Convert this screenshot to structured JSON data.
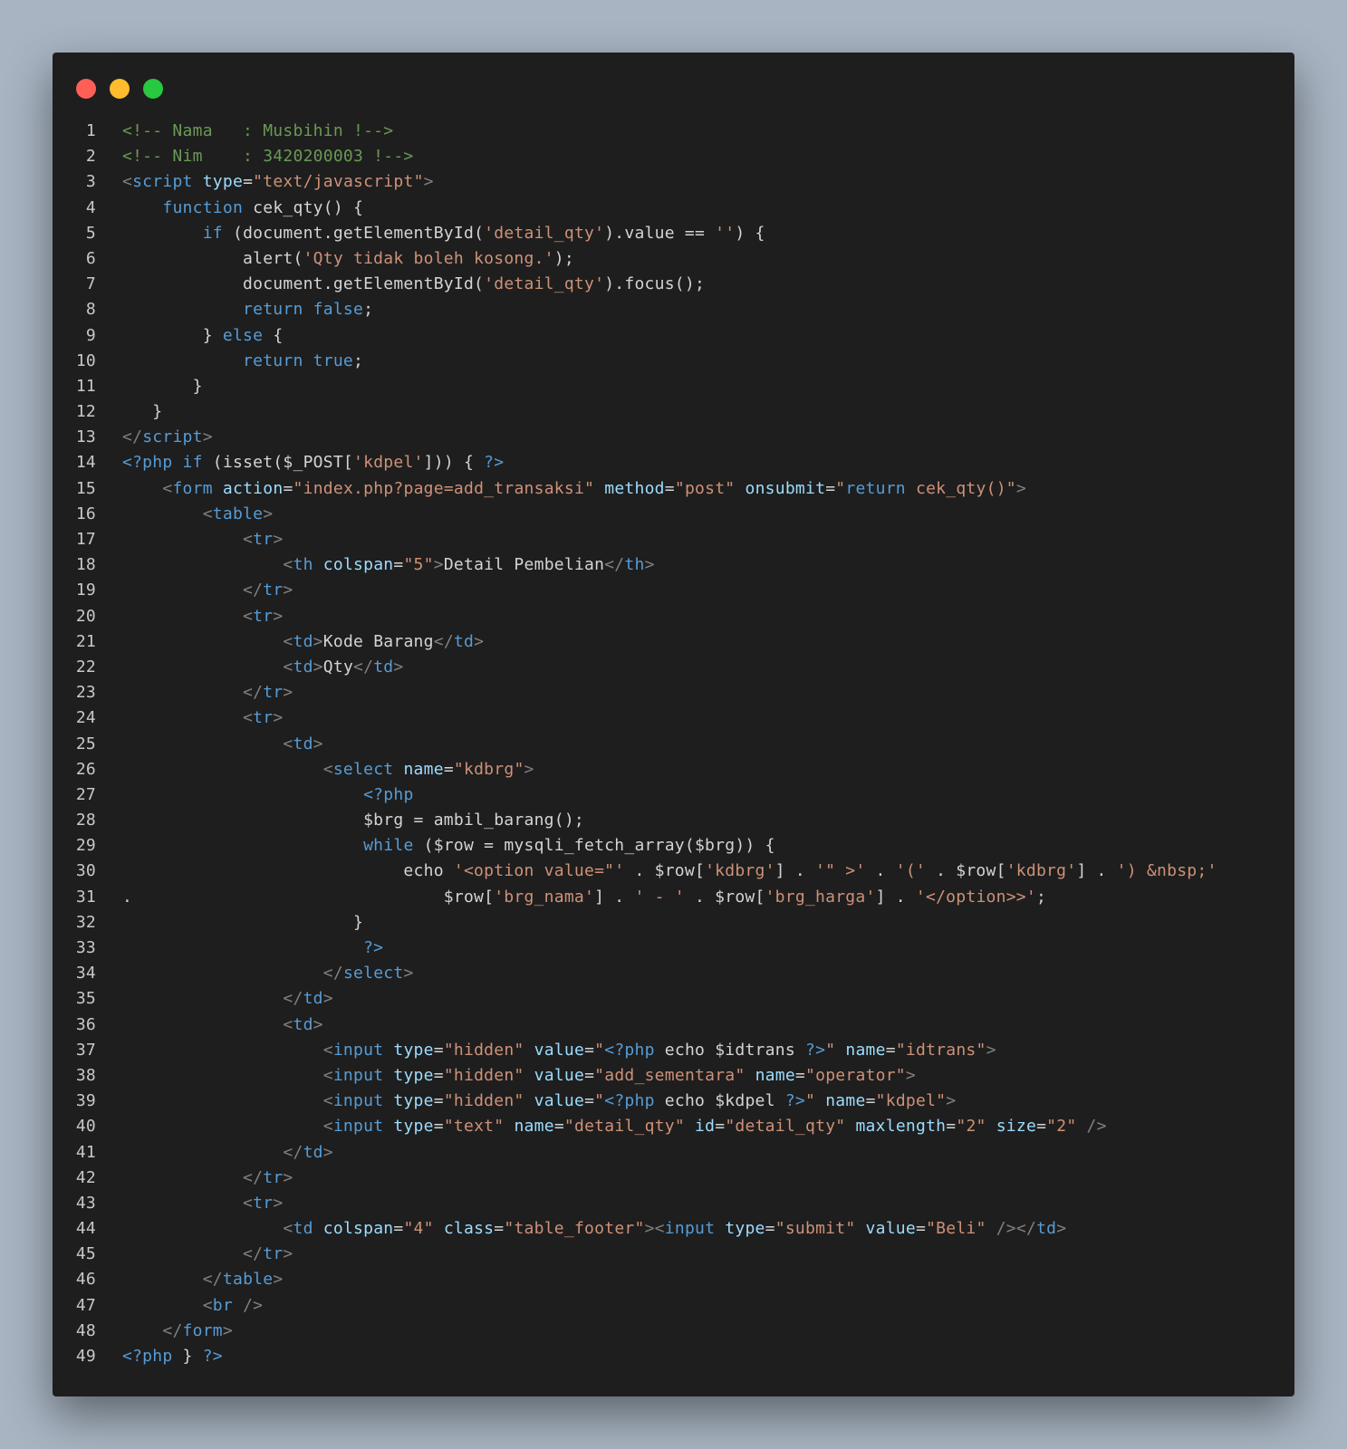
{
  "window": {
    "colors": {
      "background": "#1e1e1e",
      "close": "#ff5f57",
      "minimize": "#febc2e",
      "maximize": "#28c840"
    }
  },
  "syntax_colors": {
    "text": "#d4d4d4",
    "comment": "#6a9955",
    "tag": "#569cd6",
    "bracket": "#808080",
    "attr": "#9cdcfe",
    "string": "#ce9178",
    "keyword": "#569cd6"
  },
  "code_lines": [
    [
      [
        "comment",
        "<!-- Nama   : Musbihin !-->"
      ]
    ],
    [
      [
        "comment",
        "<!-- Nim    : 3420200003 !-->"
      ]
    ],
    [
      [
        "bracket",
        "<"
      ],
      [
        "tag",
        "script"
      ],
      [
        "text",
        " "
      ],
      [
        "attr",
        "type"
      ],
      [
        "text",
        "="
      ],
      [
        "string",
        "\"text/javascript\""
      ],
      [
        "bracket",
        ">"
      ]
    ],
    [
      [
        "text",
        "    "
      ],
      [
        "keyword",
        "function"
      ],
      [
        "text",
        " cek_qty() {"
      ]
    ],
    [
      [
        "text",
        "        "
      ],
      [
        "keyword",
        "if"
      ],
      [
        "text",
        " (document.getElementById("
      ],
      [
        "string",
        "'detail_qty'"
      ],
      [
        "text",
        ").value == "
      ],
      [
        "string",
        "''"
      ],
      [
        "text",
        ") {"
      ]
    ],
    [
      [
        "text",
        "            alert("
      ],
      [
        "string",
        "'Qty tidak boleh kosong.'"
      ],
      [
        "text",
        ");"
      ]
    ],
    [
      [
        "text",
        "            document.getElementById("
      ],
      [
        "string",
        "'detail_qty'"
      ],
      [
        "text",
        ").focus();"
      ]
    ],
    [
      [
        "text",
        "            "
      ],
      [
        "keyword",
        "return"
      ],
      [
        "text",
        " "
      ],
      [
        "keyword",
        "false"
      ],
      [
        "text",
        ";"
      ]
    ],
    [
      [
        "text",
        "        } "
      ],
      [
        "keyword",
        "else"
      ],
      [
        "text",
        " {"
      ]
    ],
    [
      [
        "text",
        "            "
      ],
      [
        "keyword",
        "return"
      ],
      [
        "text",
        " "
      ],
      [
        "keyword",
        "true"
      ],
      [
        "text",
        ";"
      ]
    ],
    [
      [
        "text",
        "       }"
      ]
    ],
    [
      [
        "text",
        "   }"
      ]
    ],
    [
      [
        "bracket",
        "</"
      ],
      [
        "tag",
        "script"
      ],
      [
        "bracket",
        ">"
      ]
    ],
    [
      [
        "php",
        "<?php"
      ],
      [
        "text",
        " "
      ],
      [
        "keyword",
        "if"
      ],
      [
        "text",
        " (isset($_POST["
      ],
      [
        "string",
        "'kdpel'"
      ],
      [
        "text",
        "])) { "
      ],
      [
        "php",
        "?>"
      ]
    ],
    [
      [
        "text",
        "    "
      ],
      [
        "bracket",
        "<"
      ],
      [
        "tag",
        "form"
      ],
      [
        "text",
        " "
      ],
      [
        "attr",
        "action"
      ],
      [
        "text",
        "="
      ],
      [
        "string",
        "\"index.php?page=add_transaksi\""
      ],
      [
        "text",
        " "
      ],
      [
        "attr",
        "method"
      ],
      [
        "text",
        "="
      ],
      [
        "string",
        "\"post\""
      ],
      [
        "text",
        " "
      ],
      [
        "attr",
        "onsubmit"
      ],
      [
        "text",
        "="
      ],
      [
        "string",
        "\""
      ],
      [
        "keyword",
        "return"
      ],
      [
        "text",
        " "
      ],
      [
        "string",
        "cek_qty()\""
      ],
      [
        "bracket",
        ">"
      ]
    ],
    [
      [
        "text",
        "        "
      ],
      [
        "bracket",
        "<"
      ],
      [
        "tag",
        "table"
      ],
      [
        "bracket",
        ">"
      ]
    ],
    [
      [
        "text",
        "            "
      ],
      [
        "bracket",
        "<"
      ],
      [
        "tag",
        "tr"
      ],
      [
        "bracket",
        ">"
      ]
    ],
    [
      [
        "text",
        "                "
      ],
      [
        "bracket",
        "<"
      ],
      [
        "tag",
        "th"
      ],
      [
        "text",
        " "
      ],
      [
        "attr",
        "colspan"
      ],
      [
        "text",
        "="
      ],
      [
        "string",
        "\"5\""
      ],
      [
        "bracket",
        ">"
      ],
      [
        "text",
        "Detail Pembelian"
      ],
      [
        "bracket",
        "</"
      ],
      [
        "tag",
        "th"
      ],
      [
        "bracket",
        ">"
      ]
    ],
    [
      [
        "text",
        "            "
      ],
      [
        "bracket",
        "</"
      ],
      [
        "tag",
        "tr"
      ],
      [
        "bracket",
        ">"
      ]
    ],
    [
      [
        "text",
        "            "
      ],
      [
        "bracket",
        "<"
      ],
      [
        "tag",
        "tr"
      ],
      [
        "bracket",
        ">"
      ]
    ],
    [
      [
        "text",
        "                "
      ],
      [
        "bracket",
        "<"
      ],
      [
        "tag",
        "td"
      ],
      [
        "bracket",
        ">"
      ],
      [
        "text",
        "Kode Barang"
      ],
      [
        "bracket",
        "</"
      ],
      [
        "tag",
        "td"
      ],
      [
        "bracket",
        ">"
      ]
    ],
    [
      [
        "text",
        "                "
      ],
      [
        "bracket",
        "<"
      ],
      [
        "tag",
        "td"
      ],
      [
        "bracket",
        ">"
      ],
      [
        "text",
        "Qty"
      ],
      [
        "bracket",
        "</"
      ],
      [
        "tag",
        "td"
      ],
      [
        "bracket",
        ">"
      ]
    ],
    [
      [
        "text",
        "            "
      ],
      [
        "bracket",
        "</"
      ],
      [
        "tag",
        "tr"
      ],
      [
        "bracket",
        ">"
      ]
    ],
    [
      [
        "text",
        "            "
      ],
      [
        "bracket",
        "<"
      ],
      [
        "tag",
        "tr"
      ],
      [
        "bracket",
        ">"
      ]
    ],
    [
      [
        "text",
        "                "
      ],
      [
        "bracket",
        "<"
      ],
      [
        "tag",
        "td"
      ],
      [
        "bracket",
        ">"
      ]
    ],
    [
      [
        "text",
        "                    "
      ],
      [
        "bracket",
        "<"
      ],
      [
        "tag",
        "select"
      ],
      [
        "text",
        " "
      ],
      [
        "attr",
        "name"
      ],
      [
        "text",
        "="
      ],
      [
        "string",
        "\"kdbrg\""
      ],
      [
        "bracket",
        ">"
      ]
    ],
    [
      [
        "text",
        "                        "
      ],
      [
        "php",
        "<?php"
      ]
    ],
    [
      [
        "text",
        "                        $brg = ambil_barang();"
      ]
    ],
    [
      [
        "text",
        "                        "
      ],
      [
        "keyword",
        "while"
      ],
      [
        "text",
        " ($row = mysqli_fetch_array($brg)) {"
      ]
    ],
    [
      [
        "text",
        "                            echo "
      ],
      [
        "string",
        "'<option value=\"'"
      ],
      [
        "text",
        " . $row["
      ],
      [
        "string",
        "'kdbrg'"
      ],
      [
        "text",
        "] . "
      ],
      [
        "string",
        "'\" >'"
      ],
      [
        "text",
        " . "
      ],
      [
        "string",
        "'('"
      ],
      [
        "text",
        " . $row["
      ],
      [
        "string",
        "'kdbrg'"
      ],
      [
        "text",
        "] . "
      ],
      [
        "string",
        "') &nbsp;'"
      ]
    ],
    [
      [
        "text",
        ".                               $row["
      ],
      [
        "string",
        "'brg_nama'"
      ],
      [
        "text",
        "] . "
      ],
      [
        "string",
        "' - '"
      ],
      [
        "text",
        " . $row["
      ],
      [
        "string",
        "'brg_harga'"
      ],
      [
        "text",
        "] . "
      ],
      [
        "string",
        "'</option>>'"
      ],
      [
        "text",
        ";"
      ]
    ],
    [
      [
        "text",
        "                       }"
      ]
    ],
    [
      [
        "text",
        "                        "
      ],
      [
        "php",
        "?>"
      ]
    ],
    [
      [
        "text",
        "                    "
      ],
      [
        "bracket",
        "</"
      ],
      [
        "tag",
        "select"
      ],
      [
        "bracket",
        ">"
      ]
    ],
    [
      [
        "text",
        "                "
      ],
      [
        "bracket",
        "</"
      ],
      [
        "tag",
        "td"
      ],
      [
        "bracket",
        ">"
      ]
    ],
    [
      [
        "text",
        "                "
      ],
      [
        "bracket",
        "<"
      ],
      [
        "tag",
        "td"
      ],
      [
        "bracket",
        ">"
      ]
    ],
    [
      [
        "text",
        "                    "
      ],
      [
        "bracket",
        "<"
      ],
      [
        "tag",
        "input"
      ],
      [
        "text",
        " "
      ],
      [
        "attr",
        "type"
      ],
      [
        "text",
        "="
      ],
      [
        "string",
        "\"hidden\""
      ],
      [
        "text",
        " "
      ],
      [
        "attr",
        "value"
      ],
      [
        "text",
        "="
      ],
      [
        "string",
        "\""
      ],
      [
        "php",
        "<?php"
      ],
      [
        "text",
        " echo $idtrans "
      ],
      [
        "php",
        "?>"
      ],
      [
        "string",
        "\""
      ],
      [
        "text",
        " "
      ],
      [
        "attr",
        "name"
      ],
      [
        "text",
        "="
      ],
      [
        "string",
        "\"idtrans\""
      ],
      [
        "bracket",
        ">"
      ]
    ],
    [
      [
        "text",
        "                    "
      ],
      [
        "bracket",
        "<"
      ],
      [
        "tag",
        "input"
      ],
      [
        "text",
        " "
      ],
      [
        "attr",
        "type"
      ],
      [
        "text",
        "="
      ],
      [
        "string",
        "\"hidden\""
      ],
      [
        "text",
        " "
      ],
      [
        "attr",
        "value"
      ],
      [
        "text",
        "="
      ],
      [
        "string",
        "\"add_sementara\""
      ],
      [
        "text",
        " "
      ],
      [
        "attr",
        "name"
      ],
      [
        "text",
        "="
      ],
      [
        "string",
        "\"operator\""
      ],
      [
        "bracket",
        ">"
      ]
    ],
    [
      [
        "text",
        "                    "
      ],
      [
        "bracket",
        "<"
      ],
      [
        "tag",
        "input"
      ],
      [
        "text",
        " "
      ],
      [
        "attr",
        "type"
      ],
      [
        "text",
        "="
      ],
      [
        "string",
        "\"hidden\""
      ],
      [
        "text",
        " "
      ],
      [
        "attr",
        "value"
      ],
      [
        "text",
        "="
      ],
      [
        "string",
        "\""
      ],
      [
        "php",
        "<?php"
      ],
      [
        "text",
        " echo $kdpel "
      ],
      [
        "php",
        "?>"
      ],
      [
        "string",
        "\""
      ],
      [
        "text",
        " "
      ],
      [
        "attr",
        "name"
      ],
      [
        "text",
        "="
      ],
      [
        "string",
        "\"kdpel\""
      ],
      [
        "bracket",
        ">"
      ]
    ],
    [
      [
        "text",
        "                    "
      ],
      [
        "bracket",
        "<"
      ],
      [
        "tag",
        "input"
      ],
      [
        "text",
        " "
      ],
      [
        "attr",
        "type"
      ],
      [
        "text",
        "="
      ],
      [
        "string",
        "\"text\""
      ],
      [
        "text",
        " "
      ],
      [
        "attr",
        "name"
      ],
      [
        "text",
        "="
      ],
      [
        "string",
        "\"detail_qty\""
      ],
      [
        "text",
        " "
      ],
      [
        "attr",
        "id"
      ],
      [
        "text",
        "="
      ],
      [
        "string",
        "\"detail_qty\""
      ],
      [
        "text",
        " "
      ],
      [
        "attr",
        "maxlength"
      ],
      [
        "text",
        "="
      ],
      [
        "string",
        "\"2\""
      ],
      [
        "text",
        " "
      ],
      [
        "attr",
        "size"
      ],
      [
        "text",
        "="
      ],
      [
        "string",
        "\"2\""
      ],
      [
        "text",
        " "
      ],
      [
        "bracket",
        "/>"
      ]
    ],
    [
      [
        "text",
        "                "
      ],
      [
        "bracket",
        "</"
      ],
      [
        "tag",
        "td"
      ],
      [
        "bracket",
        ">"
      ]
    ],
    [
      [
        "text",
        "            "
      ],
      [
        "bracket",
        "</"
      ],
      [
        "tag",
        "tr"
      ],
      [
        "bracket",
        ">"
      ]
    ],
    [
      [
        "text",
        "            "
      ],
      [
        "bracket",
        "<"
      ],
      [
        "tag",
        "tr"
      ],
      [
        "bracket",
        ">"
      ]
    ],
    [
      [
        "text",
        "                "
      ],
      [
        "bracket",
        "<"
      ],
      [
        "tag",
        "td"
      ],
      [
        "text",
        " "
      ],
      [
        "attr",
        "colspan"
      ],
      [
        "text",
        "="
      ],
      [
        "string",
        "\"4\""
      ],
      [
        "text",
        " "
      ],
      [
        "attr",
        "class"
      ],
      [
        "text",
        "="
      ],
      [
        "string",
        "\"table_footer\""
      ],
      [
        "bracket",
        "><"
      ],
      [
        "tag",
        "input"
      ],
      [
        "text",
        " "
      ],
      [
        "attr",
        "type"
      ],
      [
        "text",
        "="
      ],
      [
        "string",
        "\"submit\""
      ],
      [
        "text",
        " "
      ],
      [
        "attr",
        "value"
      ],
      [
        "text",
        "="
      ],
      [
        "string",
        "\"Beli\""
      ],
      [
        "text",
        " "
      ],
      [
        "bracket",
        "/></"
      ],
      [
        "tag",
        "td"
      ],
      [
        "bracket",
        ">"
      ]
    ],
    [
      [
        "text",
        "            "
      ],
      [
        "bracket",
        "</"
      ],
      [
        "tag",
        "tr"
      ],
      [
        "bracket",
        ">"
      ]
    ],
    [
      [
        "text",
        "        "
      ],
      [
        "bracket",
        "</"
      ],
      [
        "tag",
        "table"
      ],
      [
        "bracket",
        ">"
      ]
    ],
    [
      [
        "text",
        "        "
      ],
      [
        "bracket",
        "<"
      ],
      [
        "tag",
        "br"
      ],
      [
        "text",
        " "
      ],
      [
        "bracket",
        "/>"
      ]
    ],
    [
      [
        "text",
        "    "
      ],
      [
        "bracket",
        "</"
      ],
      [
        "tag",
        "form"
      ],
      [
        "bracket",
        ">"
      ]
    ],
    [
      [
        "php",
        "<?php"
      ],
      [
        "text",
        " } "
      ],
      [
        "php",
        "?>"
      ]
    ]
  ]
}
